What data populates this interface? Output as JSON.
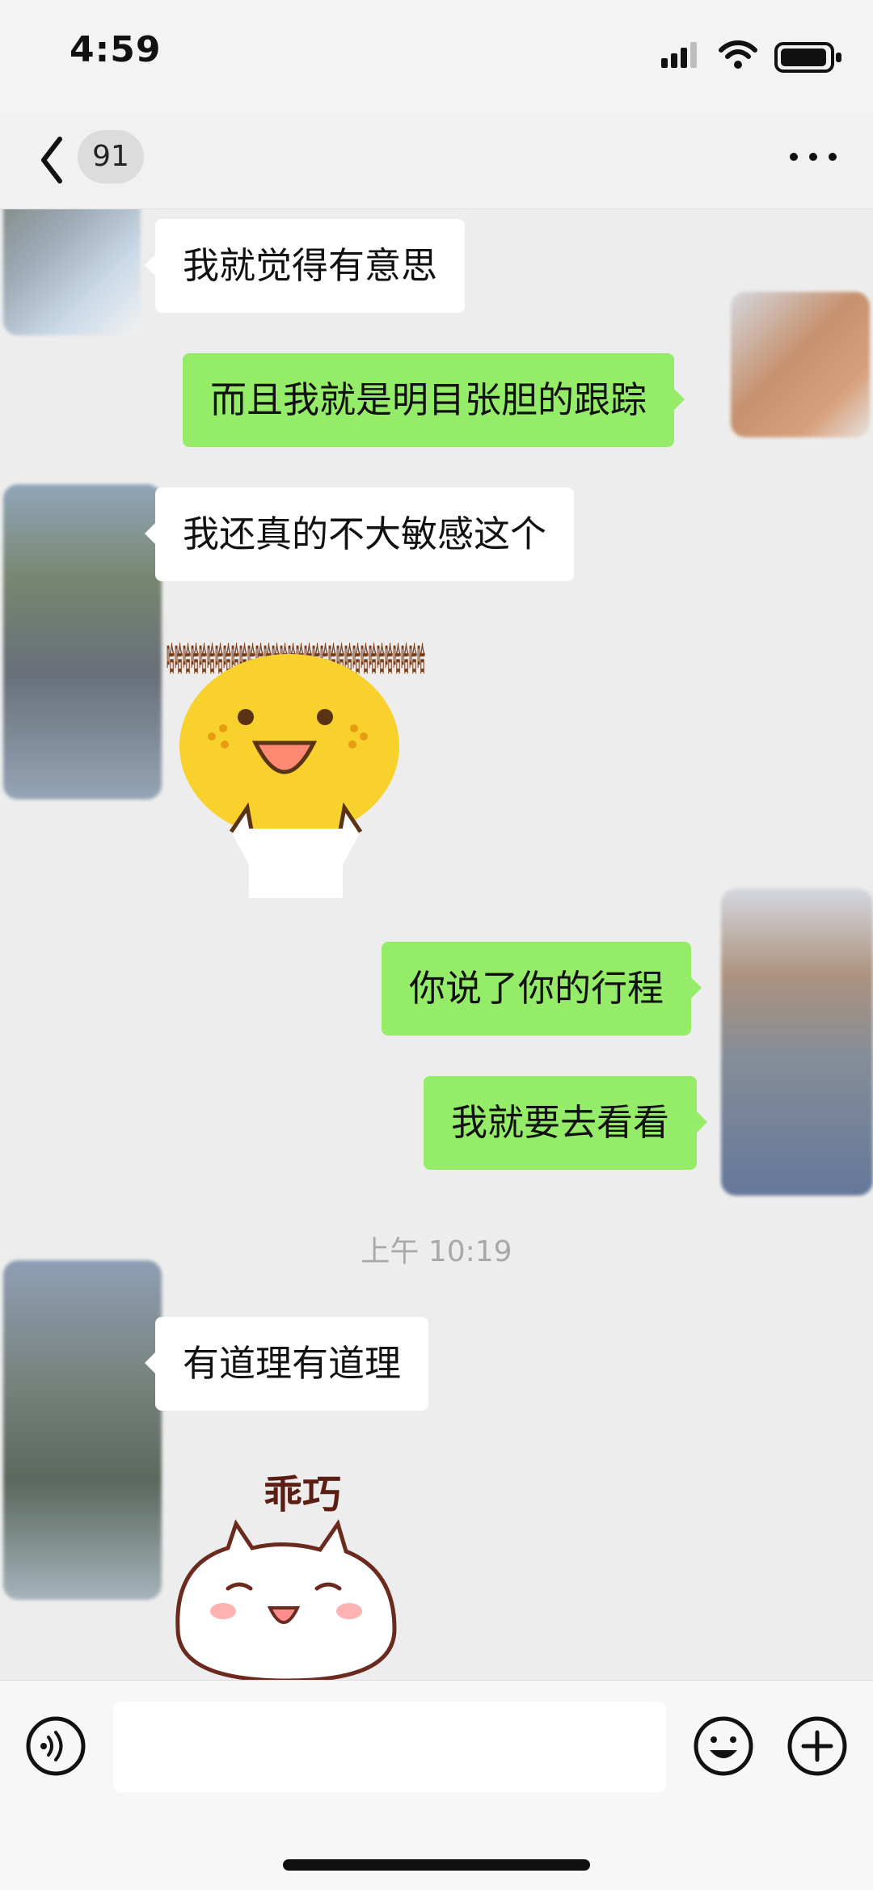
{
  "status_bar": {
    "time": "4:59",
    "icons": [
      "signal-icon",
      "wifi-icon",
      "battery-icon"
    ]
  },
  "header": {
    "unread_count": "91",
    "icons": [
      "back-chevron-icon",
      "more-horizontal-icon"
    ]
  },
  "messages": [
    {
      "side": "left",
      "text": "我就觉得有意思"
    },
    {
      "side": "right",
      "text": "而且我就是明目张胆的跟踪"
    },
    {
      "side": "left",
      "text": "我还真的不大敏感这个"
    },
    {
      "side": "left",
      "sticker_text": "哈哈哈哈哈哈哈哈哈哈哈哈哈哈哈哈哈哈哈哈哈哈哈哈哈哈哈哈哈哈哈哈"
    },
    {
      "side": "right",
      "text": "你说了你的行程"
    },
    {
      "side": "right",
      "text": "我就要去看看"
    },
    {
      "side": "left",
      "text": "有道理有道理"
    },
    {
      "side": "left",
      "sticker_text": "乖巧"
    }
  ],
  "timestamp": "上午 10:19",
  "input_bar": {
    "placeholder": "",
    "value": "",
    "icons": [
      "voice-icon",
      "emoji-icon",
      "plus-icon"
    ]
  },
  "colors": {
    "page_background": "#ededed",
    "incoming_bubble": "#ffffff",
    "outgoing_bubble": "#95ec69",
    "timestamp_text": "#a8a8a8"
  }
}
